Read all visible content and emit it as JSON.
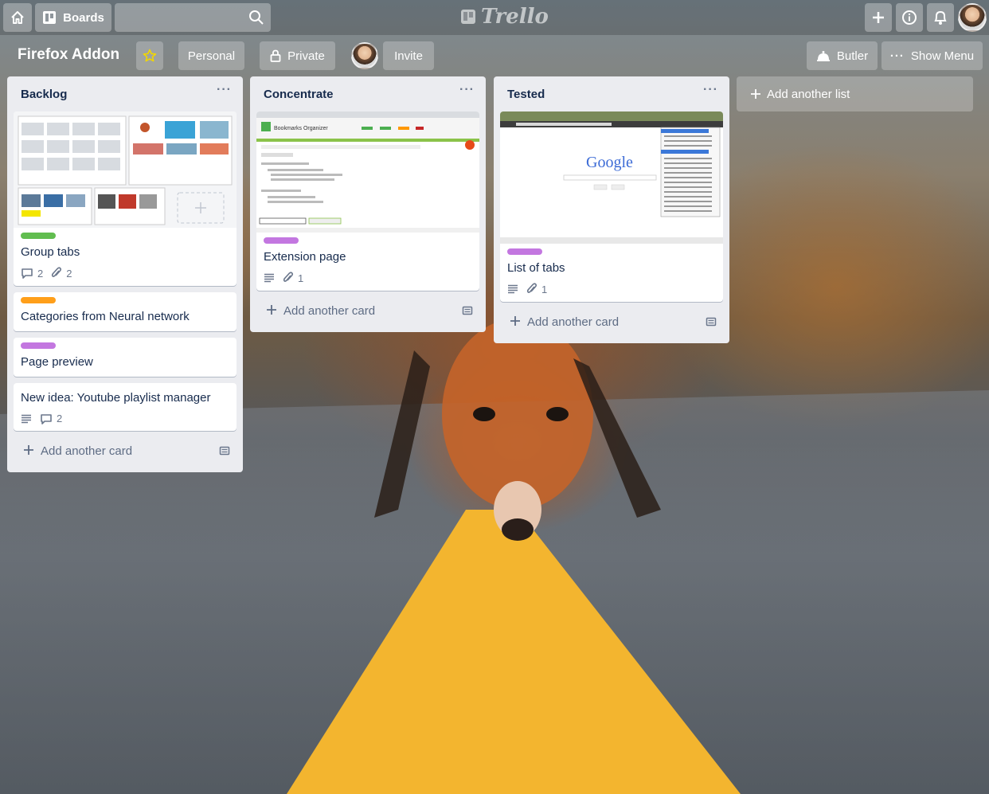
{
  "header": {
    "boards_label": "Boards",
    "search_value": "",
    "logo_text": "Trello"
  },
  "board": {
    "title": "Firefox Addon",
    "visibility_team": "Personal",
    "visibility": "Private",
    "invite_label": "Invite",
    "butler_label": "Butler",
    "show_menu_label": "Show Menu",
    "add_list_label": "Add another list"
  },
  "colors": {
    "green": "#61bd4f",
    "orange": "#ff9f1a",
    "purple": "#c377e0",
    "star": "#f2d600"
  },
  "lists": [
    {
      "title": "Backlog",
      "add_card_label": "Add another card",
      "cards": [
        {
          "title": "Group tabs",
          "label_color": "green",
          "comments": "2",
          "attachments": "2"
        },
        {
          "title": "Categories from Neural network",
          "label_color": "orange"
        },
        {
          "title": "Page preview",
          "label_color": "purple"
        },
        {
          "title": "New idea: Youtube playlist manager",
          "description": true,
          "comments": "2"
        }
      ]
    },
    {
      "title": "Concentrate",
      "add_card_label": "Add another card",
      "cards": [
        {
          "title": "Extension page",
          "label_color": "purple",
          "description": true,
          "attachments": "1",
          "cover_heading": "Bookmarks Organizer"
        }
      ]
    },
    {
      "title": "Tested",
      "add_card_label": "Add another card",
      "cards": [
        {
          "title": "List of tabs",
          "label_color": "purple",
          "description": true,
          "attachments": "1",
          "cover_logo": "Google"
        }
      ]
    }
  ]
}
